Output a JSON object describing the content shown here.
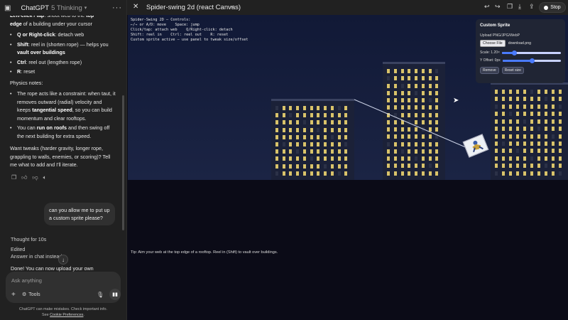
{
  "chat": {
    "model_name": "ChatGPT",
    "model_variant": "5 Thinking",
    "top_lines": [
      {
        "pre": "",
        "bold": "Left-click / tap",
        "post": ": shoot web to the ",
        "bold2": "top",
        "post2": ""
      },
      {
        "pre": "",
        "bold": "edge",
        "post": " of a building under your cursor",
        "bold2": "",
        "post2": ""
      }
    ],
    "bullets_controls": [
      {
        "bold": "Q or Right-click",
        "text": ": detach web"
      },
      {
        "bold": "Shift",
        "text": ": reel in (shorten rope) — helps you ",
        "bold2": "vault over buildings"
      },
      {
        "bold": "Ctrl",
        "text": ": reel out (lengthen rope)"
      },
      {
        "bold": "R",
        "text": ": reset"
      }
    ],
    "physics_heading": "Physics notes:",
    "bullets_physics": [
      {
        "text": "The rope acts like a constraint: when taut, it removes outward (radial) velocity and keeps ",
        "bold": "tangential speed",
        "text2": ", so you can build momentum and clear rooftops."
      },
      {
        "text": "You can ",
        "bold": "run on roofs",
        "text2": " and then swing off the next building for extra speed."
      }
    ],
    "closing_text": "Want tweaks (harder gravity, longer rope, grappling to walls, enemies, or scoring)? Tell me what to add and I'll iterate.",
    "user_message": "can you allow me to put up a custom sprite please?",
    "thought_label": "Thought for 10s",
    "edited_label": "Edited",
    "answer_in_chat": "Answer in chat instead",
    "done_text": "Done! You can now upload your own",
    "composer_placeholder": "Ask anything",
    "tools_label": "Tools",
    "disclaimer_line1": "ChatGPT can make mistakes. Check important info.",
    "disclaimer_see": "See",
    "disclaimer_link": "Cookie Preferences",
    "disclaimer_end": "."
  },
  "canvas": {
    "title": "Spider-swing 2d (react Canvas)",
    "stop_label": "Stop",
    "hud_lines": [
      "Spider-Swing 2D — Controls:",
      "←/→ or A/D: move    Space: jump",
      "Click/tap: attach web    Q/Right-click: detach",
      "Shift: reel in    Ctrl: reel out    R: reset",
      "Custom sprite active — use panel to tweak size/offset"
    ],
    "tip": "Tip: Aim your web at the top edge of a rooftop. Reel in (Shift) to vault over buildings.",
    "sprite_panel": {
      "title": "Custom Sprite",
      "upload_label": "Upload PNG/JPG/WebP",
      "choose_file": "Choose File",
      "file_name": "download.png",
      "scale_label": "Scale: 1.20×",
      "scale_fraction": 0.2,
      "yoffset_label": "Y Offset: 0px",
      "yoffset_fraction": 0.5,
      "remove_label": "Remove",
      "reset_label": "Reset size"
    }
  },
  "colors": {
    "window_lit": "#d9c36a",
    "accent_slider": "#4a7bff"
  }
}
